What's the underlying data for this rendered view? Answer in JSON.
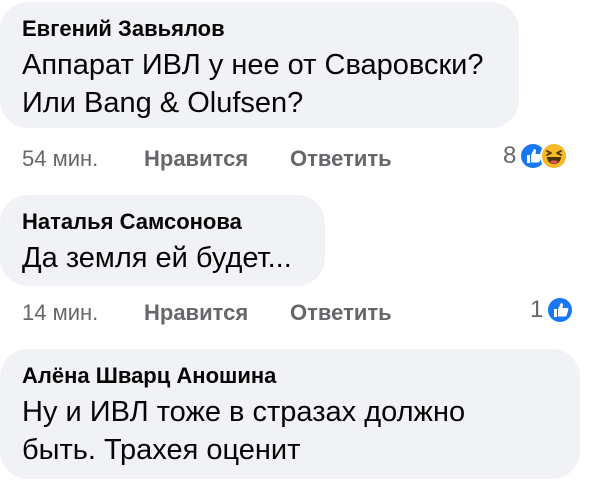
{
  "comments": [
    {
      "author": "Евгений Завьялов",
      "text": "Аппарат ИВЛ у нее от Сваровски?\nИли Bang & Olufsen?",
      "time": "54 мин.",
      "like_label": "Нравится",
      "reply_label": "Ответить",
      "reaction_count": "8",
      "reactions": [
        "like-icon",
        "haha-icon"
      ]
    },
    {
      "author": "Наталья Самсонова",
      "text": "Да земля ей будет...",
      "time": "14 мин.",
      "like_label": "Нравится",
      "reply_label": "Ответить",
      "reaction_count": "1",
      "reactions": [
        "like-icon"
      ]
    },
    {
      "author": "Алёна Шварц Аношина",
      "text": "Ну и ИВЛ тоже в стразах должно\nбыть. Трахея оценит"
    }
  ],
  "colors": {
    "bubble_bg": "#f0f2f5",
    "text": "#050505",
    "meta": "#65676b",
    "like_blue": "#1877f2",
    "haha_yellow": "#f7b928"
  }
}
